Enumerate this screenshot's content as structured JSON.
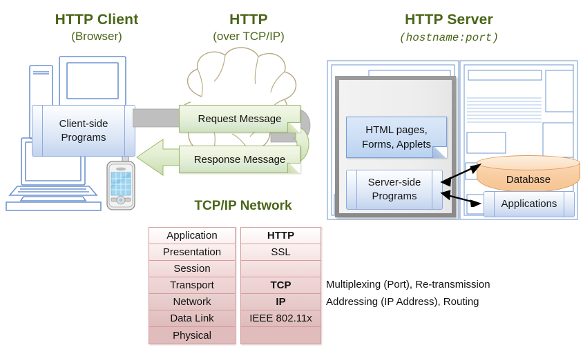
{
  "title": "HTTP Client-Server Architecture Diagram",
  "client": {
    "heading": "HTTP Client",
    "subheading": "(Browser)",
    "box_label_line1": "Client-side",
    "box_label_line2": "Programs",
    "devices": [
      "desktop-computer-icon",
      "tower-icon",
      "laptop-icon",
      "pda-phone-icon"
    ]
  },
  "network": {
    "heading": "HTTP",
    "subheading": "(over TCP/IP)",
    "cloud_label": "TCP/IP Network",
    "request_message": "Request Message",
    "response_message": "Response Message"
  },
  "server": {
    "heading": "HTTP Server",
    "subheading": "(hostname:port)",
    "content_box_line1": "HTML pages,",
    "content_box_line2": "Forms, Applets",
    "programs_box_line1": "Server-side",
    "programs_box_line2": "Programs",
    "database_label": "Database",
    "applications_label": "Applications"
  },
  "stack": {
    "layers": [
      {
        "name": "Application",
        "protocol": "HTTP",
        "protocol_bold": true,
        "note": ""
      },
      {
        "name": "Presentation",
        "protocol": "SSL",
        "protocol_bold": false,
        "note": ""
      },
      {
        "name": "Session",
        "protocol": "",
        "protocol_bold": false,
        "note": ""
      },
      {
        "name": "Transport",
        "protocol": "TCP",
        "protocol_bold": true,
        "note": "Multiplexing (Port), Re-transmission"
      },
      {
        "name": "Network",
        "protocol": "IP",
        "protocol_bold": true,
        "note": "Addressing (IP Address),  Routing"
      },
      {
        "name": "Data Link",
        "protocol": "IEEE 802.11x",
        "protocol_bold": false,
        "note": ""
      },
      {
        "name": "Physical",
        "protocol": "",
        "protocol_bold": false,
        "note": ""
      }
    ],
    "notes": [
      "Multiplexing (Port), Re-transmission",
      "Addressing (IP Address),  Routing"
    ]
  },
  "colors": {
    "heading_green": "#4a6618",
    "message_box_green": "#dcead6",
    "box_blue": "#cfe0f6",
    "database_orange": "#f8cda2",
    "stack_pink": "#e8b9b9",
    "line_art_blue": "#6d94cf",
    "arrow_gray": "#bfbfbf",
    "panel_gray": "#9b9b9b"
  }
}
